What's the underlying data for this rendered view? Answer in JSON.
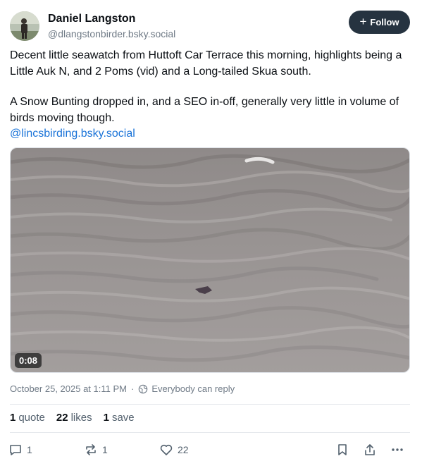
{
  "author": {
    "display_name": "Daniel Langston",
    "handle": "@dlangstonbirder.bsky.social"
  },
  "follow_button": {
    "label": "Follow",
    "icon": "plus-icon"
  },
  "post": {
    "paragraph_1": "Decent little seawatch from Huttoft Car Terrace this morning, highlights being a Little Auk N, and 2 Poms (vid) and a Long-tailed Skua south.",
    "paragraph_2": "A Snow Bunting dropped in, and a SEO in-off, generally very little in volume of birds moving though.",
    "mention": "@lincsbirding.bsky.social"
  },
  "video": {
    "duration": "0:08"
  },
  "meta": {
    "timestamp": "October 25, 2025 at 1:11 PM",
    "reply_setting": "Everybody can reply"
  },
  "stats": {
    "quotes_count": "1",
    "quotes_label": "quote",
    "likes_count": "22",
    "likes_label": "likes",
    "saves_count": "1",
    "saves_label": "save"
  },
  "actions": {
    "reply_count": "1",
    "repost_count": "1",
    "like_count": "22"
  },
  "colors": {
    "follow_button_bg": "#263340",
    "link": "#1a73d8",
    "muted_text": "#6f7a86"
  }
}
